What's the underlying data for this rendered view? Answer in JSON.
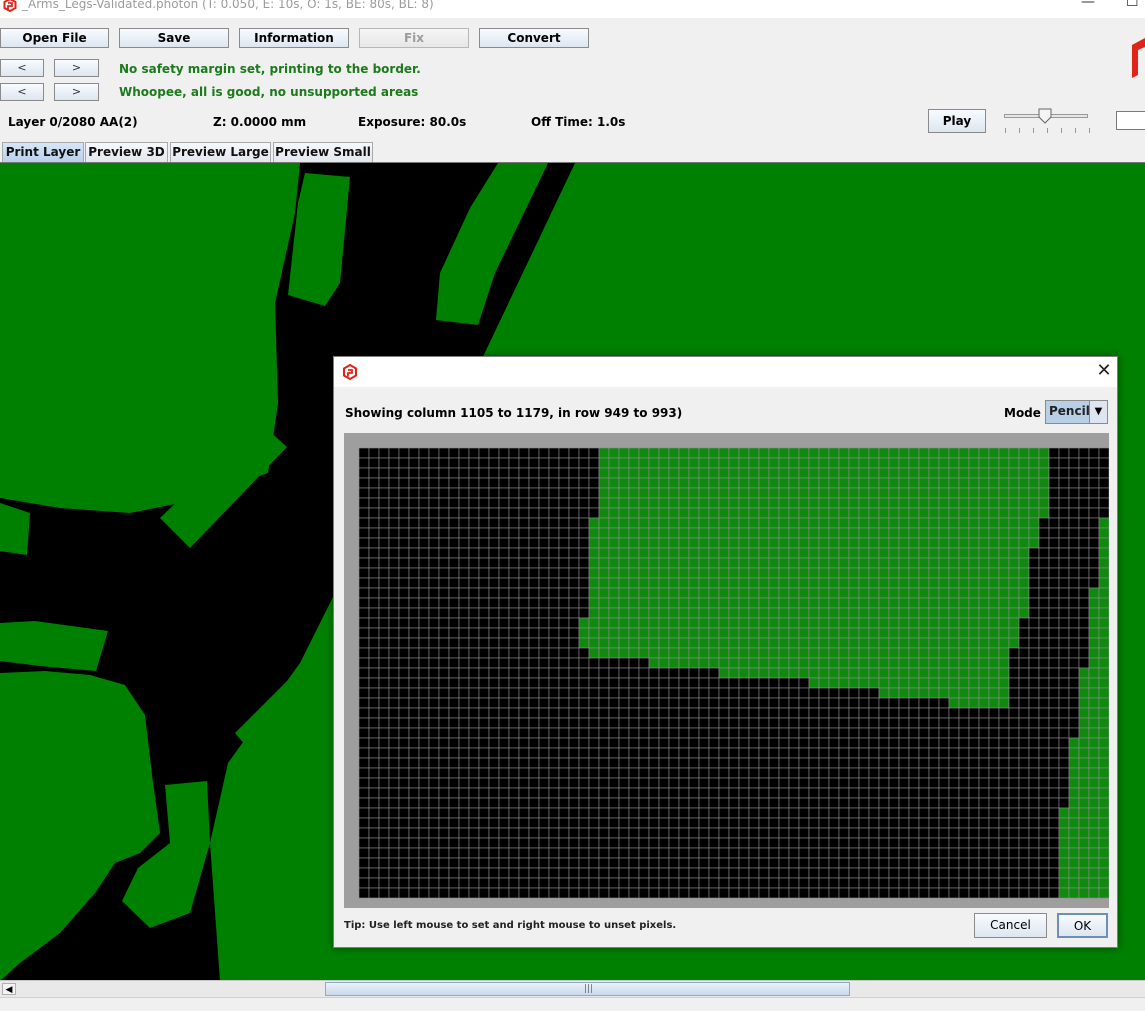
{
  "window": {
    "title": "_Arms_Legs-Validated.photon (T: 0.050, E: 10s, O: 1s, BE: 80s, BL: 8)",
    "minimize_glyph": "—",
    "restore_glyph": "☐",
    "logo_icon": "photon-logo-icon",
    "logo_color": "#e2231a"
  },
  "toolbar": {
    "open_file": "Open File",
    "save": "Save",
    "information": "Information",
    "fix": "Fix",
    "convert": "Convert",
    "prev_label": "<",
    "next_label": ">"
  },
  "status": {
    "line1": "No safety margin set, printing to the border.",
    "line2": "Whoopee, all is good, no unsupported areas",
    "color": "#1c7a1c"
  },
  "layer_info": {
    "layer": "Layer 0/2080 AA(2)",
    "z": "Z: 0.0000 mm",
    "exposure": "Exposure: 80.0s",
    "off_time": "Off Time: 1.0s",
    "play": "Play"
  },
  "tabs": [
    {
      "label": "Print Layer",
      "active": true
    },
    {
      "label": "Preview 3D",
      "active": false
    },
    {
      "label": "Preview Large",
      "active": false
    },
    {
      "label": "Preview Small",
      "active": false
    }
  ],
  "canvas": {
    "fill_color": "#008000",
    "background": "#000000"
  },
  "scrollbar": {
    "left_arrow": "◀",
    "grip": "|||"
  },
  "dialog": {
    "close_glyph": "✕",
    "showing": "Showing column 1105 to 1179, in row 949 to 993)",
    "mode_label": "Mode",
    "mode_value": "Pencil",
    "mode_arrow": "▼",
    "tip": "Tip: Use left mouse to set and right mouse to unset pixels.",
    "cancel": "Cancel",
    "ok": "OK",
    "grid": {
      "columns": 75,
      "rows": 45,
      "visible_columns": 75,
      "set_color": "#0f8a0f",
      "unset_color": "#000000",
      "line_color": "#8c8c8c"
    }
  }
}
